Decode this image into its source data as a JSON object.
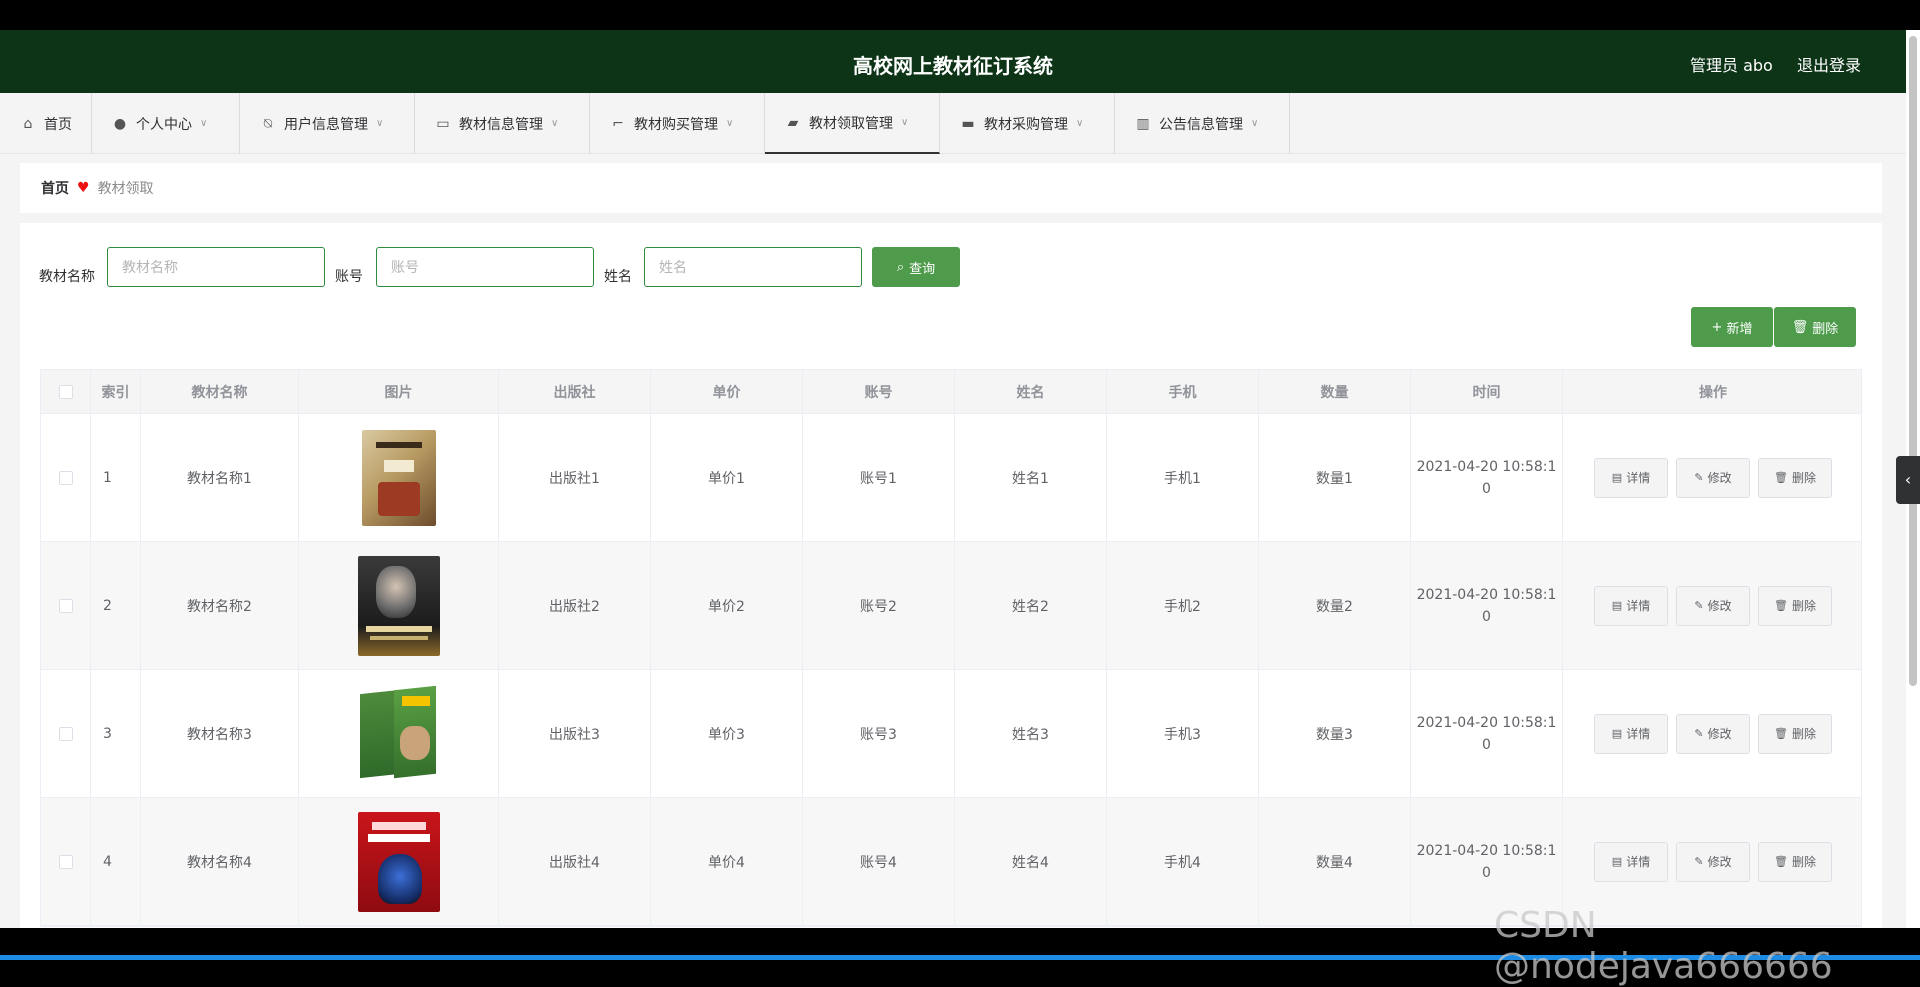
{
  "header": {
    "title": "高校网上教材征订系统",
    "admin": "管理员 abo",
    "logout": "退出登录"
  },
  "nav": [
    {
      "label": "首页",
      "icon": "home-icon"
    },
    {
      "label": "个人中心",
      "icon": "user-icon"
    },
    {
      "label": "用户信息管理",
      "icon": "bell-off-icon"
    },
    {
      "label": "教材信息管理",
      "icon": "chat-icon"
    },
    {
      "label": "教材购买管理",
      "icon": "crop-icon"
    },
    {
      "label": "教材领取管理",
      "icon": "briefcase-icon"
    },
    {
      "label": "教材采购管理",
      "icon": "monitor-icon"
    },
    {
      "label": "公告信息管理",
      "icon": "chart-icon"
    }
  ],
  "breadcrumb": {
    "home": "首页",
    "current": "教材领取"
  },
  "search": {
    "name_label": "教材名称",
    "name_placeholder": "教材名称",
    "account_label": "账号",
    "account_placeholder": "账号",
    "person_label": "姓名",
    "person_placeholder": "姓名",
    "query": "查询"
  },
  "actions": {
    "add": "新增",
    "delete": "删除"
  },
  "table": {
    "headers": [
      "索引",
      "教材名称",
      "图片",
      "出版社",
      "单价",
      "账号",
      "姓名",
      "手机",
      "数量",
      "时间",
      "操作"
    ],
    "rows": [
      {
        "index": "1",
        "name": "教材名称1",
        "publisher": "出版社1",
        "price": "单价1",
        "account": "账号1",
        "person": "姓名1",
        "phone": "手机1",
        "qty": "数量1",
        "time1": "2021-04-20 10:58:1",
        "time2": "0"
      },
      {
        "index": "2",
        "name": "教材名称2",
        "publisher": "出版社2",
        "price": "单价2",
        "account": "账号2",
        "person": "姓名2",
        "phone": "手机2",
        "qty": "数量2",
        "time1": "2021-04-20 10:58:1",
        "time2": "0"
      },
      {
        "index": "3",
        "name": "教材名称3",
        "publisher": "出版社3",
        "price": "单价3",
        "account": "账号3",
        "person": "姓名3",
        "phone": "手机3",
        "qty": "数量3",
        "time1": "2021-04-20 10:58:1",
        "time2": "0"
      },
      {
        "index": "4",
        "name": "教材名称4",
        "publisher": "出版社4",
        "price": "单价4",
        "account": "账号4",
        "person": "姓名4",
        "phone": "手机4",
        "qty": "数量4",
        "time1": "2021-04-20 10:58:1",
        "time2": "0"
      }
    ],
    "ops": {
      "detail": "详情",
      "edit": "修改",
      "delete": "删除"
    }
  },
  "watermark": "CSDN @nodejava666666",
  "colors": {
    "header": "#0e3418",
    "accent": "#4e9b4c",
    "heart": "#e11111"
  }
}
